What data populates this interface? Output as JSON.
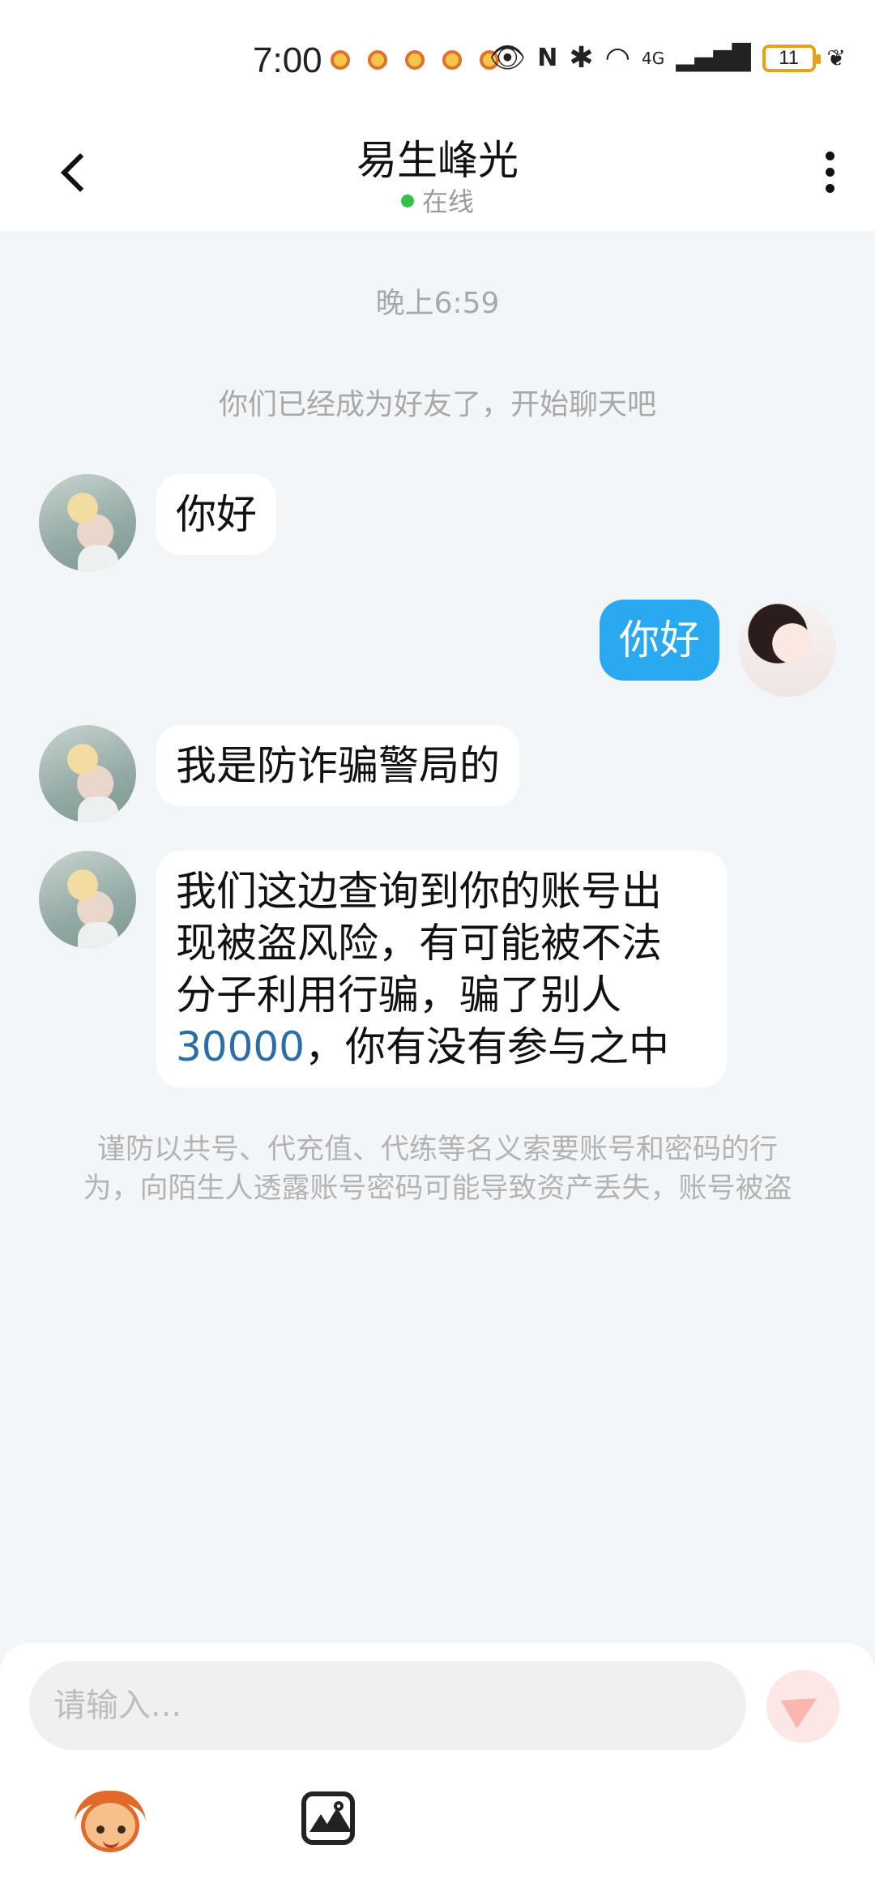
{
  "status_bar": {
    "time": "7:00",
    "battery": "11",
    "network": "4G",
    "icons": [
      "eye-icon",
      "nfc-icon",
      "bluetooth-icon",
      "wifi-icon",
      "signal-icon",
      "leaf-icon"
    ]
  },
  "header": {
    "title": "易生峰光",
    "status": "在线"
  },
  "chat": {
    "timestamp": "晚上6:59",
    "system_message": "你们已经成为好友了，开始聊天吧",
    "messages": [
      {
        "side": "incoming",
        "text": "你好"
      },
      {
        "side": "outgoing",
        "text": "你好"
      },
      {
        "side": "incoming",
        "text": "我是防诈骗警局的"
      },
      {
        "side": "incoming",
        "text_lines": [
          "我们这边查询到你的账号出",
          "现被盗风险，有可能被不法",
          "分子利用行骗，骗了别人"
        ],
        "number": "30000",
        "text_after_number": "，你有没有参与之中"
      }
    ],
    "warning": "谨防以共号、代充值、代练等名义索要账号和密码的行为，向陌生人透露账号密码可能导致资产丢失，账号被盗"
  },
  "input_bar": {
    "placeholder": "请输入..."
  },
  "colors": {
    "outgoing_bubble": "#2aa9f0",
    "online_dot": "#36c24a",
    "link_number": "#2a6da8"
  }
}
